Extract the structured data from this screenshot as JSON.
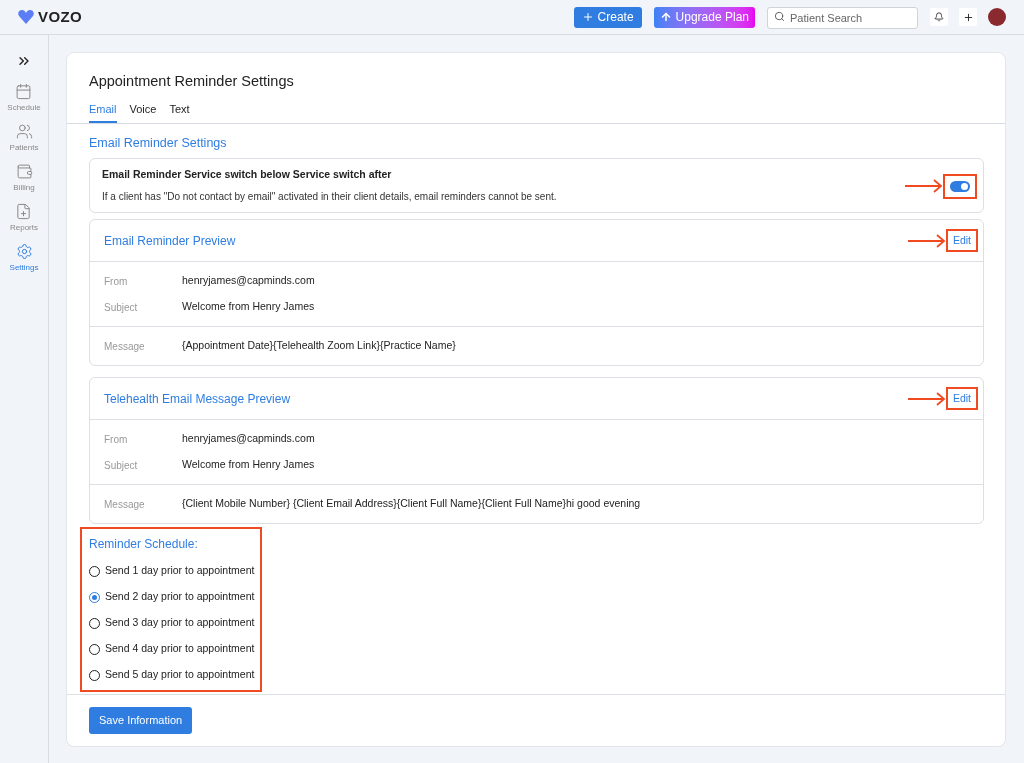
{
  "header": {
    "logo": "VOZO",
    "create_button": "Create",
    "upgrade_button": "Upgrade Plan",
    "search": {
      "placeholder": "Patient Search"
    }
  },
  "sidebar": {
    "items": [
      {
        "label": "Schedule",
        "kind": "calendar",
        "selected": false
      },
      {
        "label": "Patients",
        "kind": "people",
        "selected": false
      },
      {
        "label": "Billing",
        "kind": "wallet",
        "selected": false
      },
      {
        "label": "Reports",
        "kind": "report",
        "selected": false
      },
      {
        "label": "Settings",
        "kind": "gear",
        "selected": true
      }
    ]
  },
  "page": {
    "title": "Appointment Reminder Settings",
    "tabs": [
      {
        "label": "Email",
        "selected": true
      },
      {
        "label": "Voice",
        "selected": false
      },
      {
        "label": "Text",
        "selected": false
      }
    ],
    "section_title": "Email Reminder Settings",
    "service": {
      "title": "Email Reminder Service switch below Service switch after",
      "description": "If a client has \"Do not contact by email\" activated in their client details, email reminders cannot be sent.",
      "on": true
    },
    "previews": [
      {
        "title": "Email Reminder Preview",
        "edit": "Edit",
        "fields": [
          {
            "label": "From",
            "value": "henryjames@capminds.com"
          },
          {
            "label": "Subject",
            "value": "Welcome from Henry James"
          }
        ],
        "message": {
          "label": "Message",
          "value": "{Appointment Date}{Telehealth Zoom Link}{Practice Name}"
        }
      },
      {
        "title": "Telehealth Email Message Preview",
        "edit": "Edit",
        "fields": [
          {
            "label": "From",
            "value": "henryjames@capminds.com"
          },
          {
            "label": "Subject",
            "value": "Welcome from Henry James"
          }
        ],
        "message": {
          "label": "Message",
          "value": "{Client Mobile Number} {Client Email Address}{Client Full Name}{Client Full Name}hi good evening"
        }
      }
    ],
    "schedule": {
      "title": "Reminder Schedule:",
      "options": [
        {
          "label": "Send 1 day prior to appointment",
          "selected": false
        },
        {
          "label": "Send 2 day prior to appointment",
          "selected": true
        },
        {
          "label": "Send 3 day prior to appointment",
          "selected": false
        },
        {
          "label": "Send 4 day prior to appointment",
          "selected": false
        },
        {
          "label": "Send 5 day prior to appointment",
          "selected": false
        }
      ]
    },
    "save_button": "Save Information"
  }
}
